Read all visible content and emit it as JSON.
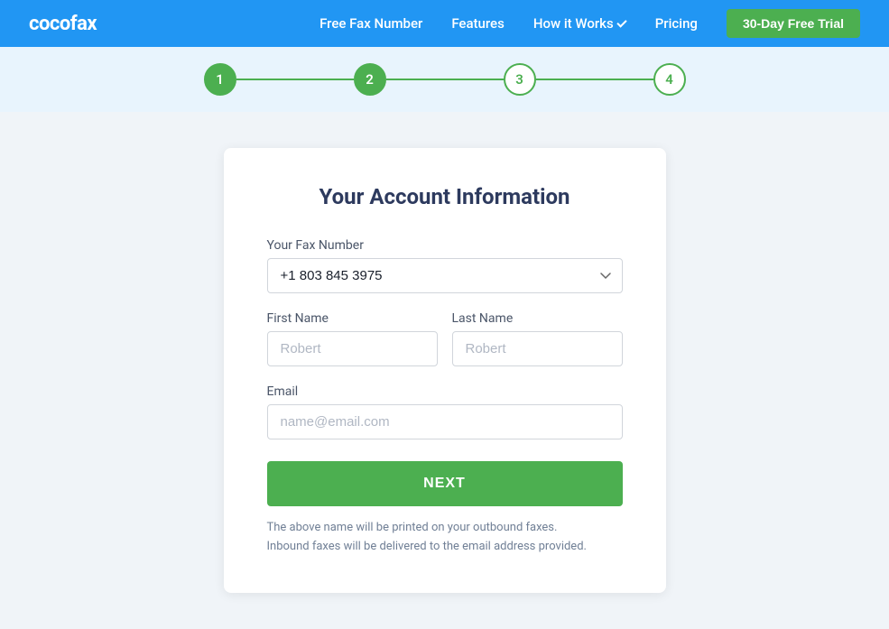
{
  "navbar": {
    "logo": "cocofax",
    "links": [
      {
        "label": "Free Fax Number",
        "id": "free-fax-number"
      },
      {
        "label": "Features",
        "id": "features"
      },
      {
        "label": "How it Works",
        "id": "how-it-works",
        "hasDropdown": true
      },
      {
        "label": "Pricing",
        "id": "pricing"
      }
    ],
    "trial_button": "30-Day Free Trial"
  },
  "stepper": {
    "steps": [
      {
        "number": "1",
        "type": "filled"
      },
      {
        "number": "2",
        "type": "filled"
      },
      {
        "number": "3",
        "type": "outline"
      },
      {
        "number": "4",
        "type": "outline"
      }
    ]
  },
  "form": {
    "title": "Your Account Information",
    "fax_number_label": "Your Fax Number",
    "fax_number_value": "+1 803 845 3975",
    "first_name_label": "First Name",
    "first_name_placeholder": "Robert",
    "last_name_label": "Last Name",
    "last_name_placeholder": "Robert",
    "email_label": "Email",
    "email_placeholder": "name@email.com",
    "next_button": "NEXT",
    "note_line1": "The above name will be printed on your outbound faxes.",
    "note_line2": "Inbound faxes will be delivered to the email address provided."
  }
}
